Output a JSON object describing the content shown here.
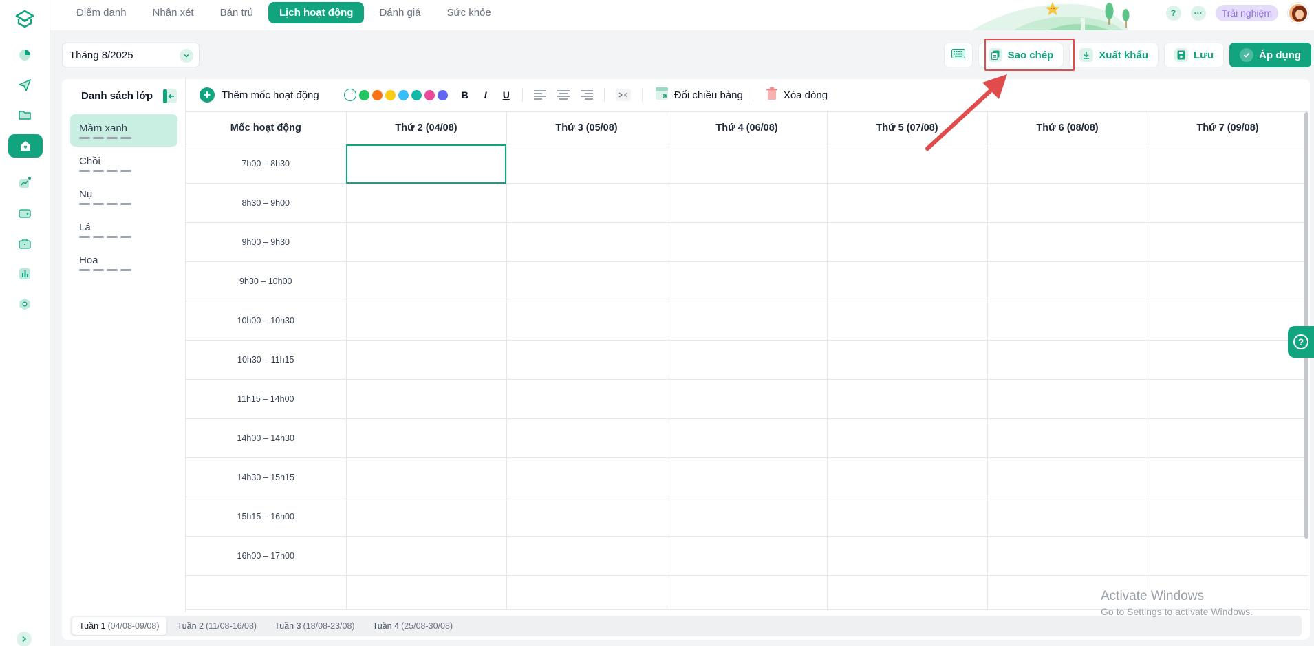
{
  "topbar": {
    "tabs": [
      {
        "label": "Điểm danh"
      },
      {
        "label": "Nhận xét"
      },
      {
        "label": "Bán trú"
      },
      {
        "label": "Lịch hoạt động",
        "active": true
      },
      {
        "label": "Đánh giá"
      },
      {
        "label": "Sức khỏe"
      }
    ],
    "help_label": "?",
    "more_label": "···",
    "trial_label": "Trải nghiệm"
  },
  "toolbar": {
    "month_value": "Tháng 8/2025",
    "copy_label": "Sao chép",
    "export_label": "Xuất khẩu",
    "save_label": "Lưu",
    "apply_label": "Áp dụng"
  },
  "classes": {
    "title": "Danh sách lớp",
    "items": [
      {
        "name": "Mầm xanh",
        "active": true
      },
      {
        "name": "Chồi"
      },
      {
        "name": "Nụ"
      },
      {
        "name": "Lá"
      },
      {
        "name": "Hoa"
      }
    ]
  },
  "format_bar": {
    "add_label": "Thêm mốc hoạt động",
    "colors": [
      "#22c55e",
      "#f97316",
      "#facc15",
      "#38bdf8",
      "#14b8a6",
      "#ec4899",
      "#6366f1"
    ],
    "bold": "B",
    "italic": "I",
    "underline": "U",
    "transpose_label": "Đổi chiều bảng",
    "delete_label": "Xóa dòng"
  },
  "schedule": {
    "headers": [
      "Mốc hoạt động",
      "Thứ 2 (04/08)",
      "Thứ 3 (05/08)",
      "Thứ 4 (06/08)",
      "Thứ 5 (07/08)",
      "Thứ 6 (08/08)",
      "Thứ 7 (09/08)"
    ],
    "slots": [
      "7h00 – 8h30",
      "8h30 – 9h00",
      "9h00 – 9h30",
      "9h30 – 10h00",
      "10h00 – 10h30",
      "10h30 – 11h15",
      "11h15 – 14h00",
      "14h00 – 14h30",
      "14h30 – 15h15",
      "15h15 – 16h00",
      "16h00 – 17h00"
    ]
  },
  "weeks": [
    {
      "label": "Tuần 1",
      "range": "(04/08-09/08)",
      "active": true
    },
    {
      "label": "Tuần 2",
      "range": "(11/08-16/08)"
    },
    {
      "label": "Tuần 3",
      "range": "(18/08-23/08)"
    },
    {
      "label": "Tuần 4",
      "range": "(25/08-30/08)"
    }
  ],
  "watermark": {
    "title": "Activate Windows",
    "subtitle": "Go to Settings to activate Windows."
  },
  "colors": {
    "accent": "#12a37f",
    "accent_soft": "#dcf3ec",
    "highlight": "#e04b4b"
  }
}
